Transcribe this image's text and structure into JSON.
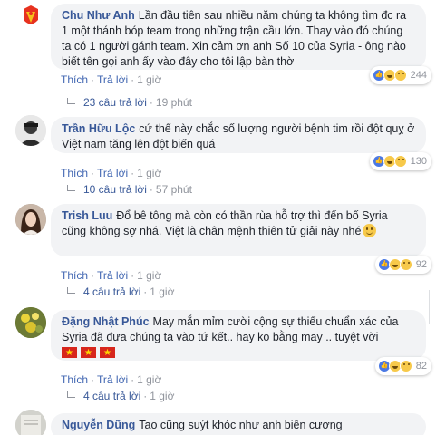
{
  "comments": [
    {
      "author": "Chu Như Anh",
      "text": "Lần đầu tiên sau nhiều năm chúng ta không tìm đc ra 1 một thánh bóp team trong những trận cầu lớn. Thay vào đó chúng ta có 1 người gánh team. Xin cảm ơn anh Số 10 của Syria - ông nào biết tên gọi anh ấy vào đây cho tôi lập bàn thờ",
      "like": "Thích",
      "reply": "Trả lời",
      "time": "1 giờ",
      "reactions": "244",
      "replies_label": "23 câu trả lời",
      "replies_time": "19 phút",
      "avatar": "red-emblem-avatar"
    },
    {
      "author": "Trần Hữu Lộc",
      "text": "cứ thế này chắc số lượng người bệnh tim rồi đột quỵ ở Việt nam tăng lên đột biến quá",
      "like": "Thích",
      "reply": "Trả lời",
      "time": "1 giờ",
      "reactions": "130",
      "replies_label": "10 câu trả lời",
      "replies_time": "57 phút",
      "avatar": "man-avatar"
    },
    {
      "author": "Trish Luu",
      "text": "Đổ bê tông mà còn có thần rùa hỗ trợ thì đến bố Syria cũng không sợ nhá. Việt là chân mệnh thiên tử giải này nhé",
      "like": "Thích",
      "reply": "Trả lời",
      "time": "1 giờ",
      "reactions": "92",
      "replies_label": "4 câu trả lời",
      "replies_time": "1 giờ",
      "avatar": "woman-avatar"
    },
    {
      "author": "Đặng Nhật Phúc",
      "text": "May mắn mỉm cười cộng sự thiếu chuẩn xác của Syria đã đưa chúng ta vào tứ kết.. hay ko bằng may .. tuyệt vời",
      "like": "Thích",
      "reply": "Trả lời",
      "time": "1 giờ",
      "reactions": "82",
      "replies_label": "4 câu trả lời",
      "replies_time": "1 giờ",
      "avatar": "flower-avatar"
    },
    {
      "author": "Nguyễn Dũng",
      "text": "Tao cũng suýt khóc như anh biên cương",
      "avatar": "paper-avatar"
    }
  ],
  "colors": {
    "author": "#385898",
    "link": "#4267b2",
    "bubble": "#f2f3f5",
    "muted": "#90949c"
  }
}
